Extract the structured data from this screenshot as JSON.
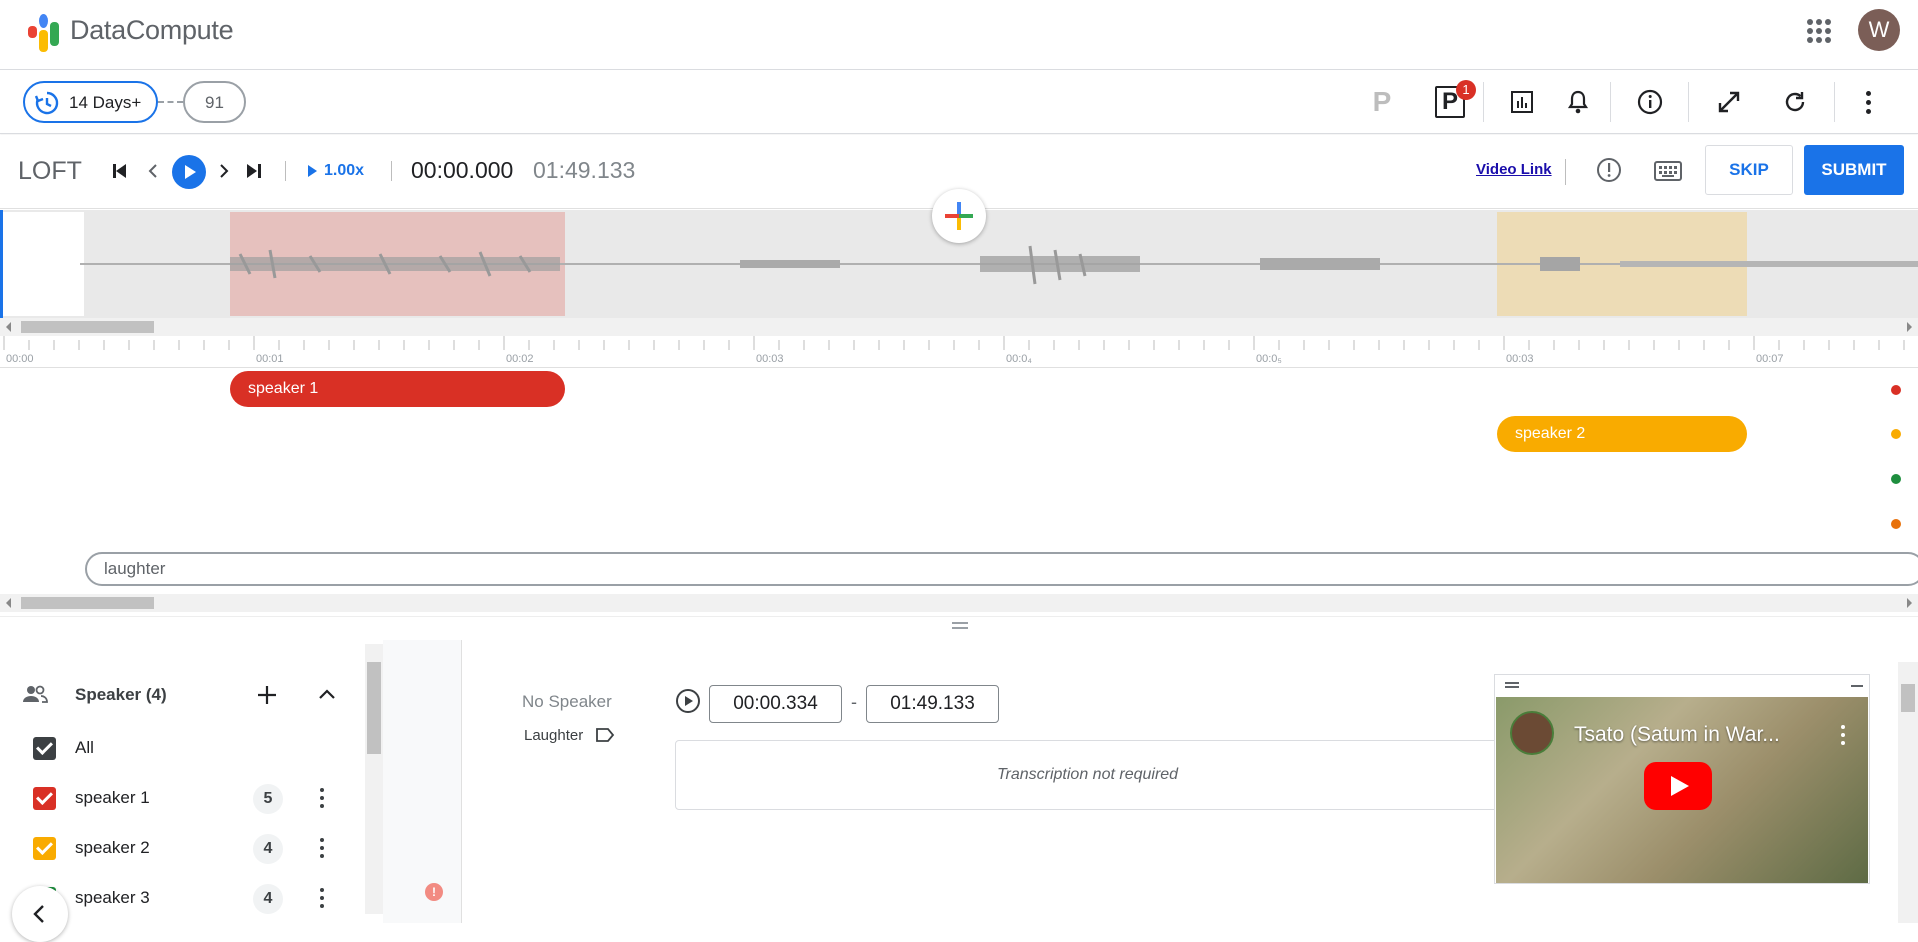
{
  "app": {
    "brand": "DataCompute",
    "avatar_letter": "W",
    "colors": {
      "accent": "#1a73e8",
      "speaker1": "#d93025",
      "speaker2": "#f9ab00",
      "speaker3": "#1e8e3e",
      "speaker4": "#e8710a"
    }
  },
  "toolbar": {
    "history_label": "14 Days+",
    "count_label": "91",
    "p_badge": "1",
    "icons": [
      "p-gray-icon",
      "p-badge-icon",
      "report-icon",
      "bell-icon",
      "info-icon",
      "expand-icon",
      "refresh-icon",
      "more-vert-icon"
    ]
  },
  "player": {
    "project": "LOFT",
    "speed": "1.00x",
    "current_time": "00:00.000",
    "total_time": "01:49.133",
    "video_link": "Video Link",
    "skip": "SKIP",
    "submit": "SUBMIT"
  },
  "ruler": {
    "labels": [
      "00:00",
      "00:01",
      "00:02",
      "00:03",
      "00:0₄",
      "00:0₅",
      "00:03",
      "00:07"
    ]
  },
  "timeline": {
    "speaker1_label": "speaker 1",
    "speaker2_label": "speaker 2",
    "laughter_label": "laughter"
  },
  "speakers": {
    "header": "Speaker (4)",
    "all_label": "All",
    "items": [
      {
        "label": "speaker 1",
        "count": "5",
        "color": "#d93025"
      },
      {
        "label": "speaker 2",
        "count": "4",
        "color": "#f9ab00"
      },
      {
        "label": "speaker 3",
        "count": "4",
        "color": "#1e8e3e"
      }
    ]
  },
  "segment": {
    "speaker": "No Speaker",
    "tag": "Laughter",
    "start": "00:00.334",
    "end": "01:49.133",
    "separator": "-",
    "transcription": "Transcription not required"
  },
  "video": {
    "title": "Tsato (Satum in War..."
  }
}
